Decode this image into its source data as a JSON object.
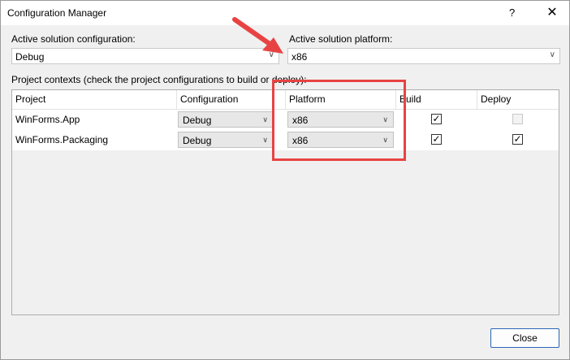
{
  "window": {
    "title": "Configuration Manager",
    "help_label": "?",
    "close_label": "✕"
  },
  "solution_config": {
    "label": "Active solution configuration:",
    "value": "Debug"
  },
  "solution_platform": {
    "label": "Active solution platform:",
    "value": "x86"
  },
  "contexts_label": "Project contexts (check the project configurations to build or deploy):",
  "grid": {
    "columns": [
      "Project",
      "Configuration",
      "Platform",
      "Build",
      "Deploy"
    ],
    "rows": [
      {
        "project": "WinForms.App",
        "configuration": "Debug",
        "platform": "x86",
        "build": true,
        "deploy": false,
        "deploy_enabled": false
      },
      {
        "project": "WinForms.Packaging",
        "configuration": "Debug",
        "platform": "x86",
        "build": true,
        "deploy": true,
        "deploy_enabled": true
      }
    ]
  },
  "close_button": "Close",
  "colors": {
    "annotation": "#e84343",
    "accent": "#2a66b8"
  }
}
